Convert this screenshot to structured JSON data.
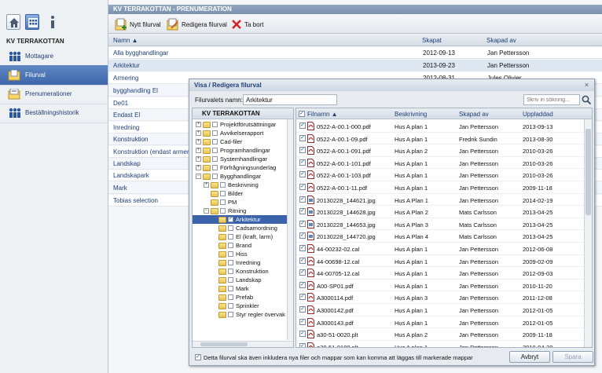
{
  "sidebar": {
    "title": "KV TERRAKOTTAN",
    "items": [
      {
        "label": "Mottagare"
      },
      {
        "label": "Filurval"
      },
      {
        "label": "Prenumerationer"
      },
      {
        "label": "Beställningshistorik"
      }
    ]
  },
  "header": {
    "title": "KV TERRAKOTTAN - PRENUMERATION"
  },
  "toolbar": {
    "new_label": "Nytt filurval",
    "edit_label": "Redigera filurval",
    "delete_label": "Ta bort"
  },
  "main": {
    "columns": [
      "Namn ▲",
      "Skapat",
      "Skapad av"
    ],
    "rows": [
      {
        "name": "Alla bygghandlingar",
        "created": "2012-09-13",
        "by": "Jan Pettersson"
      },
      {
        "name": "Arkitektur",
        "created": "2013-09-23",
        "by": "Jan Pettersson"
      },
      {
        "name": "Armering",
        "created": "2012-08-31",
        "by": "Jules Olivier"
      },
      {
        "name": "bygghandling El",
        "created": "",
        "by": ""
      },
      {
        "name": "De01",
        "created": "",
        "by": ""
      },
      {
        "name": "Endast El",
        "created": "",
        "by": ""
      },
      {
        "name": "Inredning",
        "created": "",
        "by": ""
      },
      {
        "name": "Konstruktion",
        "created": "",
        "by": ""
      },
      {
        "name": "Konstruktion (endast armering)",
        "created": "",
        "by": ""
      },
      {
        "name": "Landskap",
        "created": "",
        "by": ""
      },
      {
        "name": "Landskapark",
        "created": "",
        "by": ""
      },
      {
        "name": "Mark",
        "created": "",
        "by": ""
      },
      {
        "name": "Tobias selection",
        "created": "",
        "by": ""
      }
    ]
  },
  "dialog": {
    "title": "Visa / Redigera filurval",
    "close": "×",
    "name_label": "Filurvalets namn:",
    "name_value": "Arkitektur",
    "search_placeholder": "Skriv in sökning...",
    "tree_root": "KV TERRAKOTTAN",
    "tree": [
      {
        "label": "Projektförutsättningar"
      },
      {
        "label": "Avvikelserapport"
      },
      {
        "label": "Cad-filer"
      },
      {
        "label": "Programhandlingar"
      },
      {
        "label": "Systemhandlingar"
      },
      {
        "label": "Förfrågningsunderlag"
      },
      {
        "label": "Bygghandlingar"
      },
      {
        "label": "Beskrivning"
      },
      {
        "label": "Bilder"
      },
      {
        "label": "PM"
      },
      {
        "label": "Ritning"
      },
      {
        "label": "Arkitektur"
      },
      {
        "label": "Cadsamordning"
      },
      {
        "label": "El (kraft, larm)"
      },
      {
        "label": "Brand"
      },
      {
        "label": "Hiss"
      },
      {
        "label": "Inredning"
      },
      {
        "label": "Konstruktion"
      },
      {
        "label": "Landskap"
      },
      {
        "label": "Mark"
      },
      {
        "label": "Prefab"
      },
      {
        "label": "Sprinkler"
      },
      {
        "label": "Styr regler övervak"
      }
    ],
    "grid_columns": [
      "Filnamn ▲",
      "Beskrivning",
      "Skapad av",
      "Uppladdad"
    ],
    "files": [
      {
        "name": "0522-A-00.1-000.pdf",
        "desc": "Hus A plan 1",
        "by": "Jan Pettersson",
        "date": "2013-09-13"
      },
      {
        "name": "0522-A-00.1-09.pdf",
        "desc": "Hus A plan 1",
        "by": "Fredrik Sundin",
        "date": "2013-08-30"
      },
      {
        "name": "0522-A-00.1-091.pdf",
        "desc": "Hus A plan 2",
        "by": "Jan Pettersson",
        "date": "2010-03-26"
      },
      {
        "name": "0522-A-00.1-101.pdf",
        "desc": "Hus A plan 1",
        "by": "Jan Pettersson",
        "date": "2010-03-26"
      },
      {
        "name": "0522-A-00.1-103.pdf",
        "desc": "Hus A plan 1",
        "by": "Jan Pettersson",
        "date": "2010-03-26"
      },
      {
        "name": "0522-A-00.1-11.pdf",
        "desc": "Hus A plan 1",
        "by": "Jan Pettersson",
        "date": "2009-11-18"
      },
      {
        "name": "20130228_144621.jpg",
        "desc": "Hus A Plan 1",
        "by": "Jan Pettersson",
        "date": "2014-02-19"
      },
      {
        "name": "20130228_144628.jpg",
        "desc": "Hus A Plan 2",
        "by": "Mats Carlsson",
        "date": "2013-04-25"
      },
      {
        "name": "20130228_144653.jpg",
        "desc": "Hus A Plan 3",
        "by": "Mats Carlsson",
        "date": "2013-04-25"
      },
      {
        "name": "20130228_144720.jpg",
        "desc": "Hus A Plan 4",
        "by": "Mats Carlsson",
        "date": "2013-04-25"
      },
      {
        "name": "44-00232-02.cal",
        "desc": "Hus A plan 1",
        "by": "Jan Pettersson",
        "date": "2012-06-08"
      },
      {
        "name": "44-00698-12.cal",
        "desc": "Hus A plan 1",
        "by": "Jan Pettersson",
        "date": "2009-02-09"
      },
      {
        "name": "44-00705-12.cal",
        "desc": "Hus A plan 1",
        "by": "Jan Pettersson",
        "date": "2012-09-03"
      },
      {
        "name": "A00-SP01.pdf",
        "desc": "Hus A plan 1",
        "by": "Jan Pettersson",
        "date": "2010-11-20"
      },
      {
        "name": "A3000114.pdf",
        "desc": "Hus A plan 3",
        "by": "Jan Pettersson",
        "date": "2011-12-08"
      },
      {
        "name": "A3000142.pdf",
        "desc": "Hus A plan 1",
        "by": "Jan Pettersson",
        "date": "2012-01-05"
      },
      {
        "name": "A3000143.pdf",
        "desc": "Hus A plan 1",
        "by": "Jan Pettersson",
        "date": "2012-01-05"
      },
      {
        "name": "a30-51-0020.plt",
        "desc": "Hus A plan 2",
        "by": "Jan Pettersson",
        "date": "2009-11-18"
      },
      {
        "name": "a30-51-0100.plt",
        "desc": "Hus A plan 1",
        "by": "Jan Pettersson",
        "date": "2010-04-20"
      }
    ],
    "include_label": "Detta filurval ska även inkludera nya filer och mappar som kan komma att läggas till markerade mappar",
    "cancel_label": "Avbryt",
    "save_label": "Spara"
  },
  "colors": {
    "accent": "#3e67ab",
    "link": "#1f3f78",
    "titlebar": "#7c92b0"
  },
  "icons": [
    "home-icon",
    "folder-icon",
    "info-icon",
    "people-icon",
    "document-icon",
    "search-icon",
    "pdf-icon",
    "image-icon",
    "close-icon"
  ]
}
